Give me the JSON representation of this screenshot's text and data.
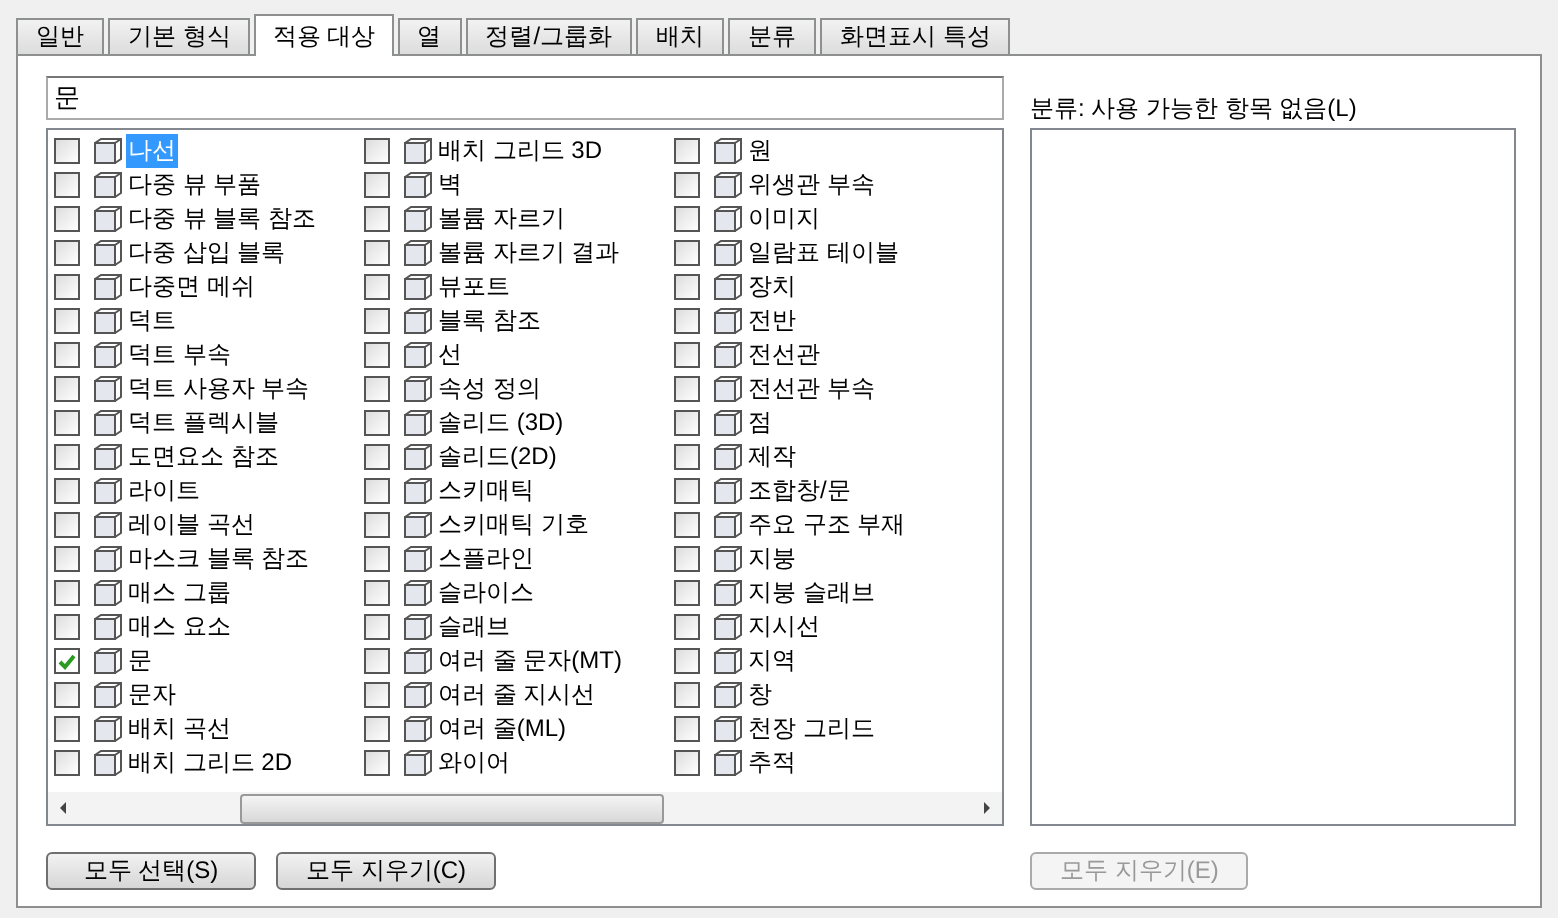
{
  "tabs": [
    {
      "label": "일반",
      "selected": false
    },
    {
      "label": "기본 형식",
      "selected": false
    },
    {
      "label": "적용 대상",
      "selected": true
    },
    {
      "label": "열",
      "selected": false
    },
    {
      "label": "정렬/그룹화",
      "selected": false
    },
    {
      "label": "배치",
      "selected": false
    },
    {
      "label": "분류",
      "selected": false
    },
    {
      "label": "화면표시 특성",
      "selected": false
    }
  ],
  "filter": {
    "value": "문"
  },
  "object_list": {
    "columns": [
      {
        "items": [
          {
            "label": "나선",
            "checked": false,
            "selected": true
          },
          {
            "label": "다중 뷰 부품",
            "checked": false,
            "selected": false
          },
          {
            "label": "다중 뷰 블록 참조",
            "checked": false,
            "selected": false
          },
          {
            "label": "다중 삽입 블록",
            "checked": false,
            "selected": false
          },
          {
            "label": "다중면 메쉬",
            "checked": false,
            "selected": false
          },
          {
            "label": "덕트",
            "checked": false,
            "selected": false
          },
          {
            "label": "덕트 부속",
            "checked": false,
            "selected": false
          },
          {
            "label": "덕트 사용자 부속",
            "checked": false,
            "selected": false
          },
          {
            "label": "덕트 플렉시블",
            "checked": false,
            "selected": false
          },
          {
            "label": "도면요소 참조",
            "checked": false,
            "selected": false
          },
          {
            "label": "라이트",
            "checked": false,
            "selected": false
          },
          {
            "label": "레이블 곡선",
            "checked": false,
            "selected": false
          },
          {
            "label": "마스크 블록 참조",
            "checked": false,
            "selected": false
          },
          {
            "label": "매스 그룹",
            "checked": false,
            "selected": false
          },
          {
            "label": "매스 요소",
            "checked": false,
            "selected": false
          },
          {
            "label": "문",
            "checked": true,
            "selected": false
          },
          {
            "label": "문자",
            "checked": false,
            "selected": false
          },
          {
            "label": "배치 곡선",
            "checked": false,
            "selected": false
          },
          {
            "label": "배치 그리드 2D",
            "checked": false,
            "selected": false
          }
        ]
      },
      {
        "items": [
          {
            "label": "배치 그리드 3D",
            "checked": false,
            "selected": false
          },
          {
            "label": "벽",
            "checked": false,
            "selected": false
          },
          {
            "label": "볼륨 자르기",
            "checked": false,
            "selected": false
          },
          {
            "label": "볼륨 자르기 결과",
            "checked": false,
            "selected": false
          },
          {
            "label": "뷰포트",
            "checked": false,
            "selected": false
          },
          {
            "label": "블록 참조",
            "checked": false,
            "selected": false
          },
          {
            "label": "선",
            "checked": false,
            "selected": false
          },
          {
            "label": "속성 정의",
            "checked": false,
            "selected": false
          },
          {
            "label": "솔리드 (3D)",
            "checked": false,
            "selected": false
          },
          {
            "label": "솔리드(2D)",
            "checked": false,
            "selected": false
          },
          {
            "label": "스키매틱",
            "checked": false,
            "selected": false
          },
          {
            "label": "스키매틱 기호",
            "checked": false,
            "selected": false
          },
          {
            "label": "스플라인",
            "checked": false,
            "selected": false
          },
          {
            "label": "슬라이스",
            "checked": false,
            "selected": false
          },
          {
            "label": "슬래브",
            "checked": false,
            "selected": false
          },
          {
            "label": "여러 줄 문자(MT)",
            "checked": false,
            "selected": false
          },
          {
            "label": "여러 줄 지시선",
            "checked": false,
            "selected": false
          },
          {
            "label": "여러 줄(ML)",
            "checked": false,
            "selected": false
          },
          {
            "label": "와이어",
            "checked": false,
            "selected": false
          }
        ]
      },
      {
        "items": [
          {
            "label": "원",
            "checked": false,
            "selected": false
          },
          {
            "label": "위생관 부속",
            "checked": false,
            "selected": false
          },
          {
            "label": "이미지",
            "checked": false,
            "selected": false
          },
          {
            "label": "일람표 테이블",
            "checked": false,
            "selected": false
          },
          {
            "label": "장치",
            "checked": false,
            "selected": false
          },
          {
            "label": "전반",
            "checked": false,
            "selected": false
          },
          {
            "label": "전선관",
            "checked": false,
            "selected": false
          },
          {
            "label": "전선관 부속",
            "checked": false,
            "selected": false
          },
          {
            "label": "점",
            "checked": false,
            "selected": false
          },
          {
            "label": "제작",
            "checked": false,
            "selected": false
          },
          {
            "label": "조합창/문",
            "checked": false,
            "selected": false
          },
          {
            "label": "주요 구조 부재",
            "checked": false,
            "selected": false
          },
          {
            "label": "지붕",
            "checked": false,
            "selected": false
          },
          {
            "label": "지붕 슬래브",
            "checked": false,
            "selected": false
          },
          {
            "label": "지시선",
            "checked": false,
            "selected": false
          },
          {
            "label": "지역",
            "checked": false,
            "selected": false
          },
          {
            "label": "창",
            "checked": false,
            "selected": false
          },
          {
            "label": "천장 그리드",
            "checked": false,
            "selected": false
          },
          {
            "label": "추적",
            "checked": false,
            "selected": false
          }
        ]
      }
    ]
  },
  "left_buttons": [
    {
      "label": "모두 선택(S)",
      "disabled": false
    },
    {
      "label": "모두 지우기(C)",
      "disabled": false
    }
  ],
  "classification": {
    "label": "분류: 사용 가능한 항목 없음(L)",
    "button": {
      "label": "모두 지우기(E)",
      "disabled": true
    }
  }
}
